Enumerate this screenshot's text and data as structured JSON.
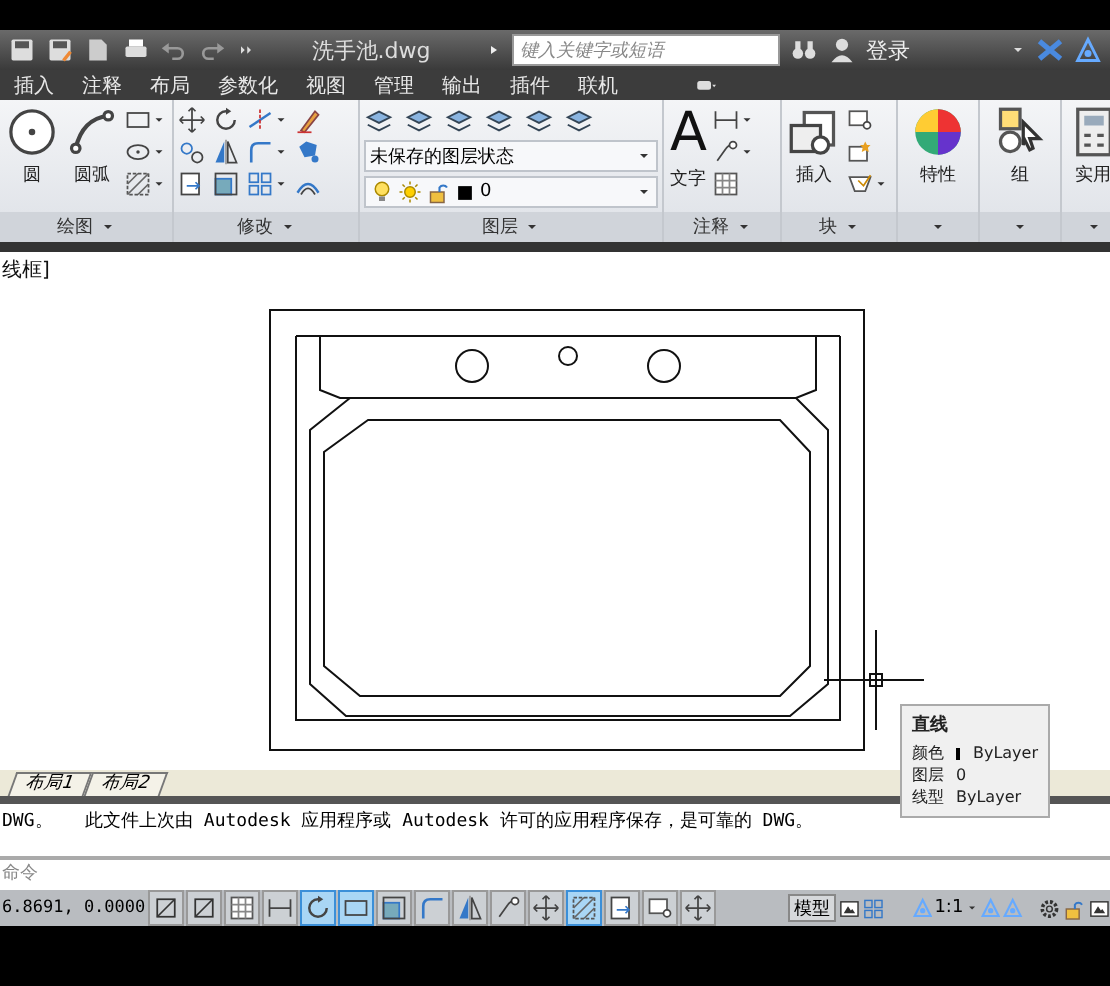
{
  "title_bar": {
    "filename": "洗手池.dwg",
    "search": {
      "placeholder": "键入关键字或短语"
    },
    "sign_in": "登录"
  },
  "menu_tabs": [
    {
      "label": "插入"
    },
    {
      "label": "注释"
    },
    {
      "label": "布局"
    },
    {
      "label": "参数化"
    },
    {
      "label": "视图"
    },
    {
      "label": "管理"
    },
    {
      "label": "输出"
    },
    {
      "label": "插件"
    },
    {
      "label": "联机"
    }
  ],
  "ribbon": {
    "panels": [
      {
        "kind": "draw",
        "title": "绘图",
        "big": [
          {
            "label": "圆"
          },
          {
            "label": "圆弧"
          }
        ]
      },
      {
        "kind": "modify",
        "title": "修改"
      },
      {
        "kind": "layers",
        "title": "图层",
        "layer_state": "未保存的图层状态",
        "current_layer": "0"
      },
      {
        "kind": "annotate",
        "title": "注释",
        "big": [
          {
            "label": "文字",
            "glyph": "A"
          }
        ]
      },
      {
        "kind": "block",
        "title": "块",
        "big": [
          {
            "label": "插入"
          }
        ]
      },
      {
        "kind": "properties",
        "big": [
          {
            "label": "特性"
          }
        ]
      },
      {
        "kind": "group",
        "big": [
          {
            "label": "组"
          }
        ]
      },
      {
        "kind": "utilities",
        "big": [
          {
            "label": "实用"
          }
        ]
      }
    ]
  },
  "viewport_label": "线框]",
  "tooltip": {
    "title": "直线",
    "rows": [
      {
        "label": "颜色",
        "value": "ByLayer",
        "color": "#000000"
      },
      {
        "label": "图层",
        "value": "0"
      },
      {
        "label": "线型",
        "value": "ByLayer"
      }
    ]
  },
  "layout_tabs": [
    {
      "label": "布局1"
    },
    {
      "label": "布局2"
    }
  ],
  "command_history": "DWG。   此文件上次由 Autodesk 应用程序或 Autodesk 许可的应用程序保存，是可靠的 DWG。",
  "command_prompt": "命令",
  "status_bar": {
    "coordinates": "6.8691, 0.0000",
    "toggles": [
      {
        "on": false
      },
      {
        "on": false
      },
      {
        "on": false
      },
      {
        "on": false
      },
      {
        "on": true
      },
      {
        "on": true
      },
      {
        "on": false
      },
      {
        "on": false
      },
      {
        "on": false
      },
      {
        "on": false
      },
      {
        "on": false
      },
      {
        "on": true
      },
      {
        "on": false
      },
      {
        "on": false
      },
      {
        "on": false
      }
    ],
    "model_button": "模型",
    "annotation_scale": "1:1"
  }
}
